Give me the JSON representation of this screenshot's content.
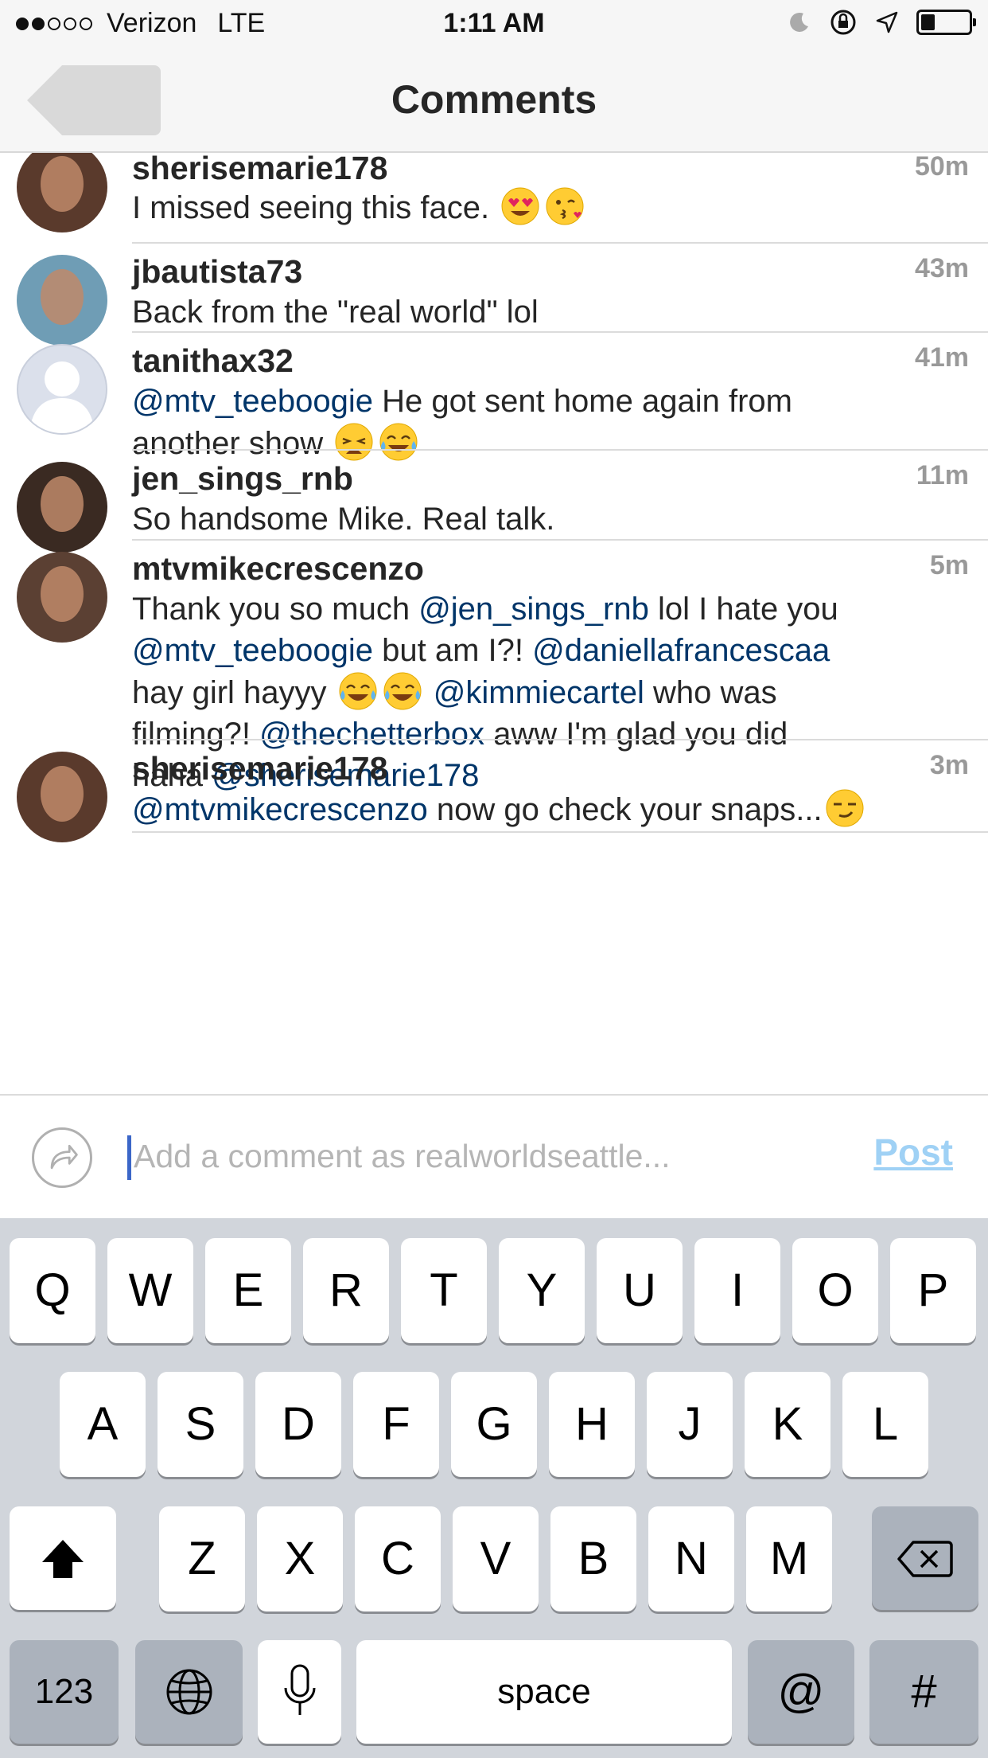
{
  "status_bar": {
    "carrier": "Verizon",
    "network": "LTE",
    "time": "1:11 AM",
    "signal_bars_filled": 2,
    "signal_bars_total": 5,
    "battery_level": 0.3,
    "icons": [
      "moon-icon",
      "rotation-lock-icon",
      "location-arrow-icon",
      "battery-icon"
    ]
  },
  "nav": {
    "title": "Comments",
    "back_icon": "back-arrow-icon"
  },
  "comments": [
    {
      "username": "sherisemarie178",
      "time": "50m",
      "avatar_color": "#5a3a2c",
      "lines": [
        [
          {
            "t": "I missed seeing this face. "
          },
          {
            "e": "heart-eyes"
          },
          {
            "e": "kiss"
          }
        ]
      ]
    },
    {
      "username": "jbautista73",
      "time": "43m",
      "avatar_color": "#6f9db5",
      "lines": [
        [
          {
            "t": "Back from the \"real world\" lol"
          }
        ]
      ]
    },
    {
      "username": "tanithax32",
      "time": "41m",
      "avatar_color": "#dbe0eb",
      "lines": [
        [
          {
            "m": "@mtv_teeboogie"
          },
          {
            "t": " He got sent home again from"
          }
        ],
        [
          {
            "t": "another show "
          },
          {
            "e": "weary"
          },
          {
            "e": "tears-of-joy"
          }
        ]
      ]
    },
    {
      "username": "jen_sings_rnb",
      "time": "11m",
      "avatar_color": "#3a2a22",
      "lines": [
        [
          {
            "t": "So handsome Mike. Real talk."
          }
        ]
      ]
    },
    {
      "username": "mtvmikecrescenzo",
      "time": "5m",
      "avatar_color": "#5b4033",
      "lines": [
        [
          {
            "t": "Thank you so much "
          },
          {
            "m": "@jen_sings_rnb"
          },
          {
            "t": " lol I hate you"
          }
        ],
        [
          {
            "m": "@mtv_teeboogie"
          },
          {
            "t": " but am I?! "
          },
          {
            "m": "@daniellafrancescaa"
          }
        ],
        [
          {
            "t": "hay girl hayyy "
          },
          {
            "e": "tears-of-joy"
          },
          {
            "e": "tears-of-joy"
          },
          {
            "t": " "
          },
          {
            "m": "@kimmiecartel"
          },
          {
            "t": " who was"
          }
        ],
        [
          {
            "t": "filming?! "
          },
          {
            "m": "@thechetterbox"
          },
          {
            "t": " aww I'm glad you did"
          }
        ],
        [
          {
            "t": "haha "
          },
          {
            "m": "@sherisemarie178"
          }
        ]
      ]
    },
    {
      "username": "sherisemarie178",
      "time": "3m",
      "avatar_color": "#5a3a2c",
      "lines": [
        [
          {
            "m": "@mtvmikecrescenzo"
          },
          {
            "t": " now go check your snaps..."
          },
          {
            "e": "smirk"
          }
        ]
      ]
    }
  ],
  "input": {
    "placeholder": "Add a comment as realworldseattle...",
    "post_label": "Post"
  },
  "keyboard": {
    "row1": [
      "Q",
      "W",
      "E",
      "R",
      "T",
      "Y",
      "U",
      "I",
      "O",
      "P"
    ],
    "row2": [
      "A",
      "S",
      "D",
      "F",
      "G",
      "H",
      "J",
      "K",
      "L"
    ],
    "row3": [
      "Z",
      "X",
      "C",
      "V",
      "B",
      "N",
      "M"
    ],
    "shift_icon": "shift-arrow-icon",
    "delete_icon": "backspace-icon",
    "numbers_label": "123",
    "globe_icon": "globe-icon",
    "mic_icon": "microphone-icon",
    "space_label": "space",
    "at_label": "@",
    "hash_label": "#"
  },
  "colors": {
    "mention": "#003569",
    "post_disabled": "#9fd1f5",
    "time": "#999999",
    "keyboard_bg": "#d1d5db"
  }
}
